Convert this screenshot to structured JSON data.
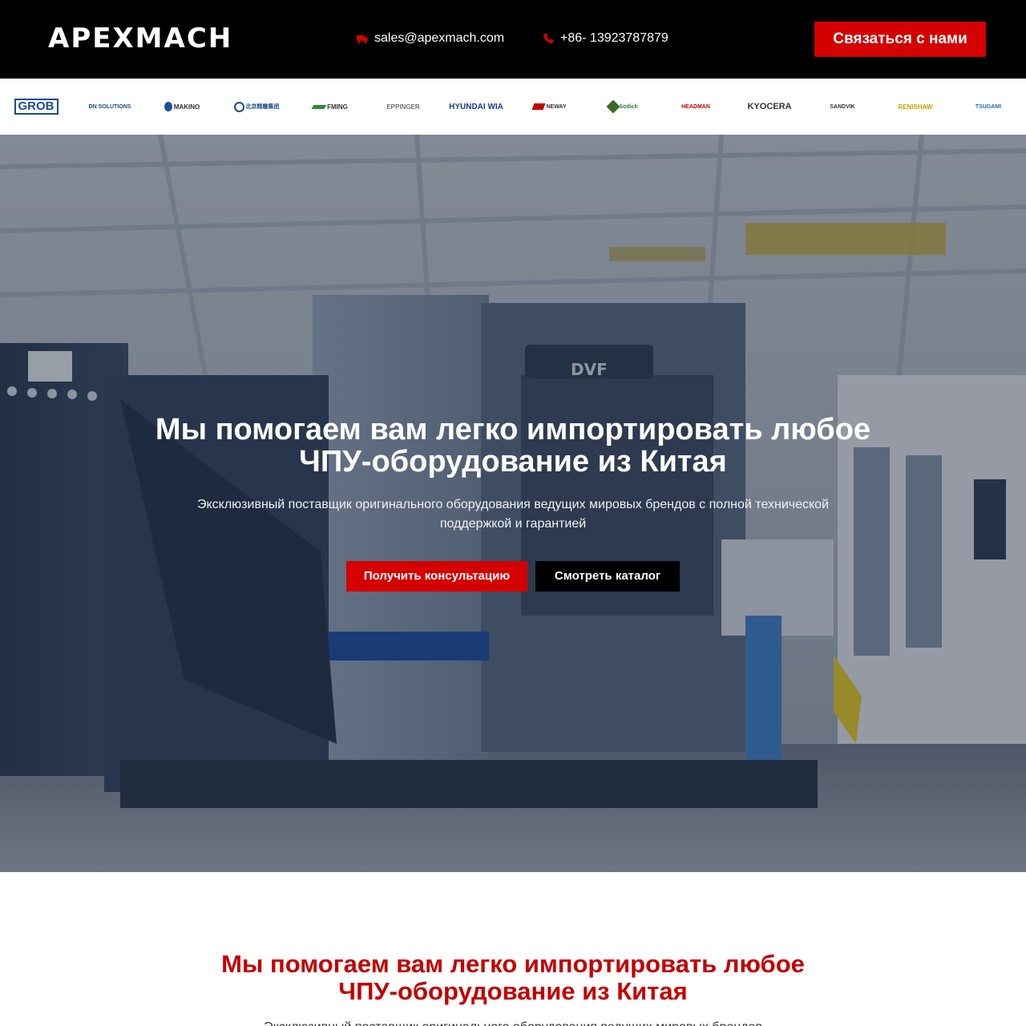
{
  "header": {
    "logo": "APEXMACH",
    "email": "sales@apexmach.com",
    "phone": "+86- 13923787879",
    "cta_label": "Связаться с нами"
  },
  "brands": [
    {
      "label": "GROB"
    },
    {
      "label": "DN SOLUTIONS"
    },
    {
      "label": "MAKINO"
    },
    {
      "label": "北京精雕集团"
    },
    {
      "label": "FMING"
    },
    {
      "label": "EPPINGER"
    },
    {
      "label": "HYUNDAI WIA"
    },
    {
      "label": "NEWAY"
    },
    {
      "label": "Sodick"
    },
    {
      "label": "HEADMAN"
    },
    {
      "label": "KYOCERA"
    },
    {
      "label": "SANDVIK"
    },
    {
      "label": "RENISHAW"
    },
    {
      "label": "TSUGAMI"
    }
  ],
  "hero": {
    "title": "Мы помогаем вам легко импортировать любое ЧПУ-оборудование из Китая",
    "subtitle": "Эксклюзивный поставщик оригинального оборудования ведущих мировых брендов с полной технической поддержкой и гарантией",
    "primary_label": "Получить консультацию",
    "secondary_label": "Смотреть каталог",
    "machine_badge": "DVF"
  },
  "section": {
    "title": "Мы помогаем вам легко импортировать любое ЧПУ-оборудование из Китая",
    "subtitle": "Эксклюзивный поставщик оригинального оборудования ведущих мировых брендов"
  },
  "colors": {
    "accent": "#d40000",
    "topbar": "#000000",
    "section_title": "#c40000"
  },
  "icons": {
    "email": "truck-icon",
    "phone": "phone-icon"
  }
}
